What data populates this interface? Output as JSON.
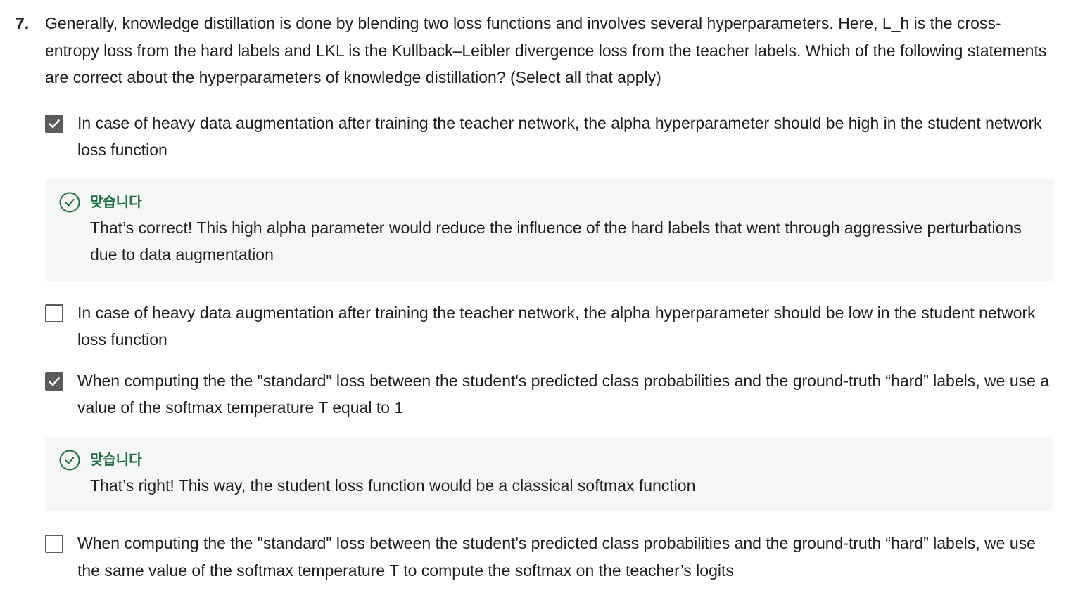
{
  "question": {
    "number": "7.",
    "text": "Generally, knowledge distillation is done by blending two loss functions and involves several hyperparameters. Here, L_h is the cross-entropy loss from the hard labels and LKL is the Kullback–Leibler divergence loss from the teacher labels. Which of the following statements are correct about the hyperparameters of knowledge distillation? (Select all that apply)"
  },
  "options": [
    {
      "text": "In case of heavy data augmentation after training the teacher network, the alpha hyperparameter should be high in the student network loss function",
      "checked": true,
      "feedback": {
        "status": "맞습니다",
        "text": "That’s correct! This high alpha parameter would reduce the influence of the hard labels that went through aggressive perturbations due to data augmentation"
      }
    },
    {
      "text": "In case of heavy data augmentation after training the teacher network, the alpha hyperparameter should be low in the student network loss function",
      "checked": false
    },
    {
      "text": "When computing the the \"standard\" loss between the student's predicted class probabilities and the ground-truth “hard” labels, we use a value of the softmax temperature T equal to 1",
      "checked": true,
      "feedback": {
        "status": "맞습니다",
        "text": "That’s right! This way, the student loss function would be a classical softmax function"
      }
    },
    {
      "text": "When computing the the \"standard\" loss between the student's predicted class probabilities and the ground-truth “hard” labels, we use the same value of the softmax temperature T to compute the softmax on the teacher’s logits",
      "checked": false
    }
  ],
  "colors": {
    "checkbox_checked": "#5b5b5b",
    "correct_green": "#1f6f43",
    "feedback_background": "#f4f7f5"
  },
  "icons": {
    "checkmark": "check-icon",
    "correct": "check-circle-icon"
  }
}
